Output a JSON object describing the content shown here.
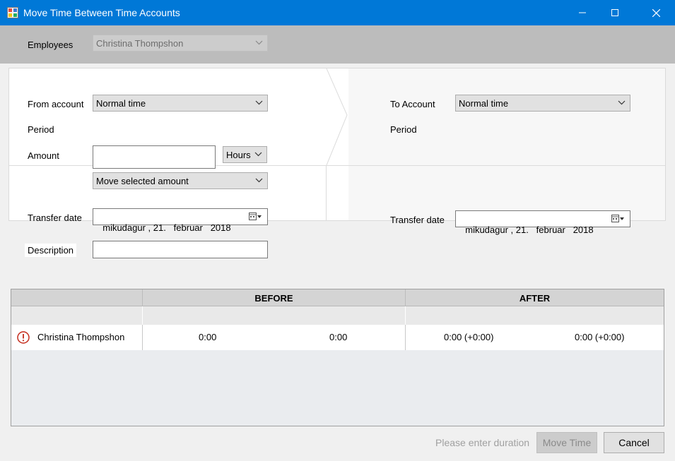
{
  "window": {
    "title": "Move Time Between Time Accounts",
    "icon": "app-window-icon",
    "controls": [
      "minimize-icon",
      "maximize-icon",
      "close-icon"
    ]
  },
  "employees": {
    "label": "Employees",
    "value": "Christina Thompshon"
  },
  "from": {
    "account_label": "From account",
    "account_value": "Normal time",
    "period_label": "Period",
    "amount_label": "Amount",
    "amount_value": "",
    "unit_value": "Hours",
    "mode_value": "Move selected amount",
    "transfer_label": "Transfer date",
    "transfer_date": "mikudagur , 21.   februar   2018"
  },
  "to": {
    "account_label": "To Account",
    "account_value": "Normal time",
    "period_label": "Period",
    "transfer_label": "Transfer date",
    "transfer_date": "mikudagur , 21.   februar   2018"
  },
  "description": {
    "label": "Description",
    "value": ""
  },
  "grid": {
    "headers": [
      "BEFORE",
      "AFTER"
    ],
    "rows": [
      {
        "status_icon": "warning-icon",
        "name": "Christina Thompshon",
        "before_from": "0:00",
        "before_to": "0:00",
        "after_from": "0:00 (+0:00)",
        "after_to": "0:00 (+0:00)"
      }
    ]
  },
  "footer": {
    "message": "Please enter duration",
    "move_label": "Move Time",
    "cancel_label": "Cancel"
  },
  "colors": {
    "titlebar": "#0078d7",
    "warning": "#c42b1c"
  }
}
